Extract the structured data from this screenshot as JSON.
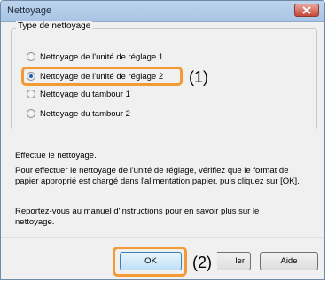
{
  "window": {
    "title": "Nettoyage"
  },
  "group": {
    "label": "Type de nettoyage"
  },
  "options": [
    {
      "label": "Nettoyage de l'unité de réglage 1",
      "checked": false
    },
    {
      "label": "Nettoyage de l'unité de réglage 2",
      "checked": true
    },
    {
      "label": "Nettoyage du tambour 1",
      "checked": false
    },
    {
      "label": "Nettoyage du tambour 2",
      "checked": false
    }
  ],
  "callouts": {
    "one": "(1)",
    "two": "(2)"
  },
  "info": {
    "heading": "Effectue le nettoyage.",
    "line1": "Pour effectuer le nettoyage de l'unité de réglage, vérifiez que le format de",
    "line2": "papier approprié est chargé dans l'alimentation papier, puis cliquez sur [OK].",
    "line3": "Reportez-vous au manuel d'instructions pour en savoir plus sur le",
    "line4": "nettoyage."
  },
  "buttons": {
    "ok": "OK",
    "cancel": "ler",
    "help": "Aide"
  },
  "colors": {
    "highlight": "#f39a35",
    "radio_checked": "#1c5fb8"
  }
}
